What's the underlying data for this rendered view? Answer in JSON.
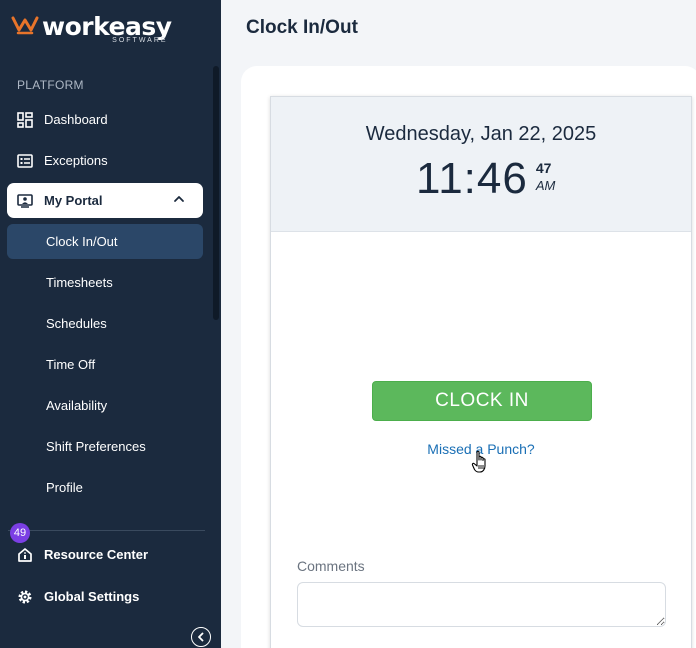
{
  "app": {
    "logo_word": "workeasy",
    "logo_sub": "SOFTWARE",
    "brand_color": "#e8742a"
  },
  "sidebar": {
    "section_label": "PLATFORM",
    "items": [
      {
        "label": "Dashboard",
        "icon": "dashboard-icon"
      },
      {
        "label": "Exceptions",
        "icon": "list-icon"
      },
      {
        "label": "My Portal",
        "icon": "portal-icon",
        "expanded": true
      }
    ],
    "portal_sub_items": [
      {
        "label": "Clock In/Out",
        "selected": true
      },
      {
        "label": "Timesheets"
      },
      {
        "label": "Schedules"
      },
      {
        "label": "Time Off"
      },
      {
        "label": "Availability"
      },
      {
        "label": "Shift Preferences"
      },
      {
        "label": "Profile"
      }
    ],
    "badge_count": "49",
    "bottom_items": [
      {
        "label": "Resource Center",
        "icon": "home-icon"
      },
      {
        "label": "Global Settings",
        "icon": "gear-icon"
      }
    ]
  },
  "main": {
    "page_title": "Clock In/Out",
    "clock": {
      "date": "Wednesday, Jan 22, 2025",
      "time": "11:46",
      "seconds": "47",
      "ampm": "AM"
    },
    "clock_in_label": "CLOCK IN",
    "missed_punch_label": "Missed a Punch?",
    "comments_label": "Comments",
    "comments_value": "",
    "colors": {
      "clock_in_button": "#5cb85c",
      "link": "#1a6fb5",
      "sidebar_bg": "#1b2a3e"
    }
  }
}
